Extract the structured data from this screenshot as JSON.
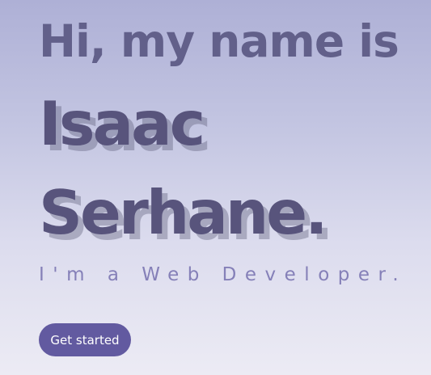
{
  "hero": {
    "intro": "Hi, my name is",
    "first_name": "Isaac",
    "last_name": "Serhane.",
    "role": "I'm a Web Developer.",
    "cta_label": "Get started"
  },
  "colors": {
    "intro_text": "#62608a",
    "name_text": "#58547c",
    "role_text": "#8580b8",
    "button_bg": "#625aa0",
    "button_text": "#ffffff"
  }
}
